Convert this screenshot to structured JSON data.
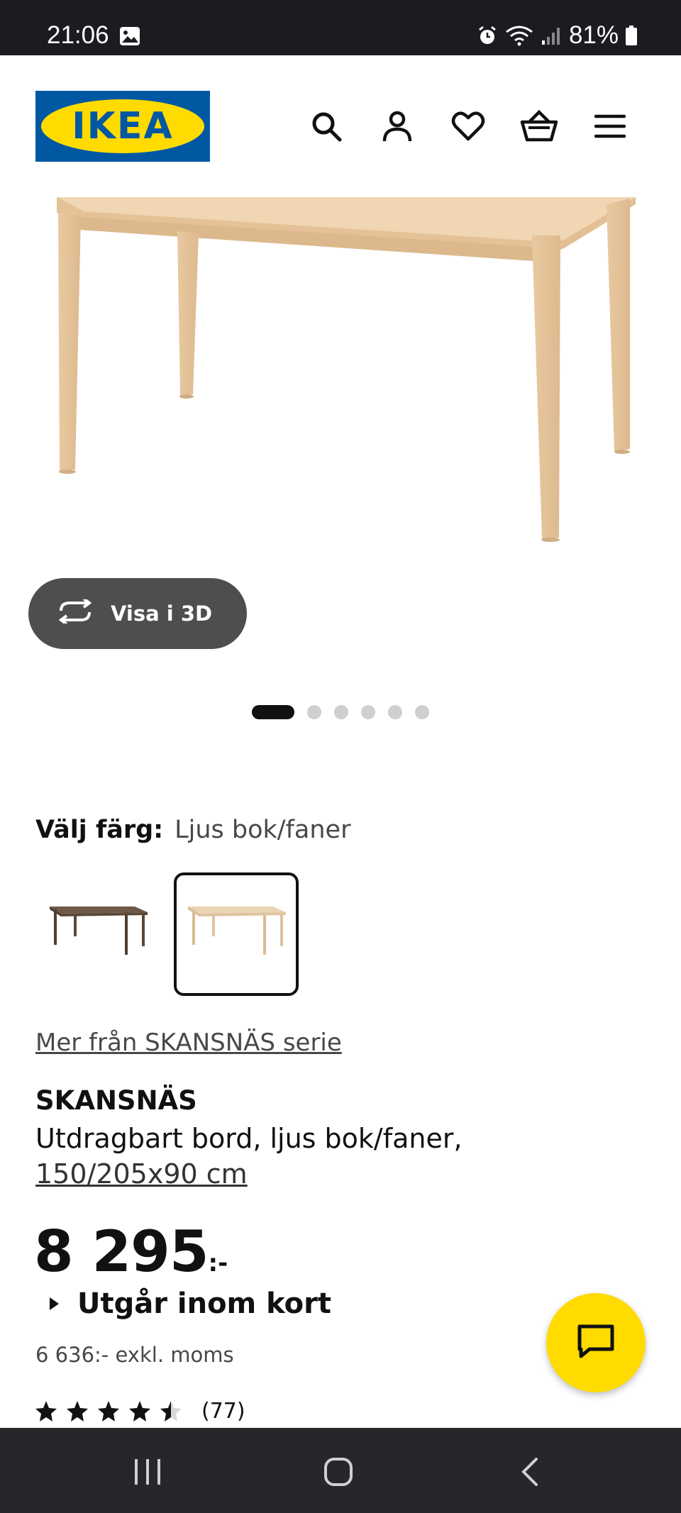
{
  "status_bar": {
    "time": "21:06",
    "battery": "81%"
  },
  "header": {
    "logo_text": "IKEA",
    "icons": [
      "search-icon",
      "account-icon",
      "wishlist-heart-icon",
      "cart-basket-icon",
      "menu-icon"
    ]
  },
  "gallery": {
    "view_3d_label": "Visa i 3D",
    "image_count": 6,
    "active_index": 0
  },
  "color_selector": {
    "label": "Välj färg:",
    "selected_value": "Ljus bok/faner",
    "swatches": [
      "dark-brown-table",
      "light-beech-table"
    ],
    "selected_index": 1
  },
  "series_link": "Mer från SKANSNÄS serie",
  "product": {
    "name": "SKANSNÄS",
    "description": "Utdragbart bord, ljus bok/faner,",
    "dimensions": "150/205x90 cm"
  },
  "price": {
    "amount": "8 295",
    "suffix": ":-",
    "excl_vat": "6 636:- exkl. moms"
  },
  "availability": {
    "text": "Utgår inom kort"
  },
  "rating": {
    "stars": 4.5,
    "count": "(77)"
  },
  "colors": {
    "ikea_blue": "#0058a3",
    "ikea_yellow": "#ffdb00",
    "button_dark": "#4e4e4e"
  }
}
